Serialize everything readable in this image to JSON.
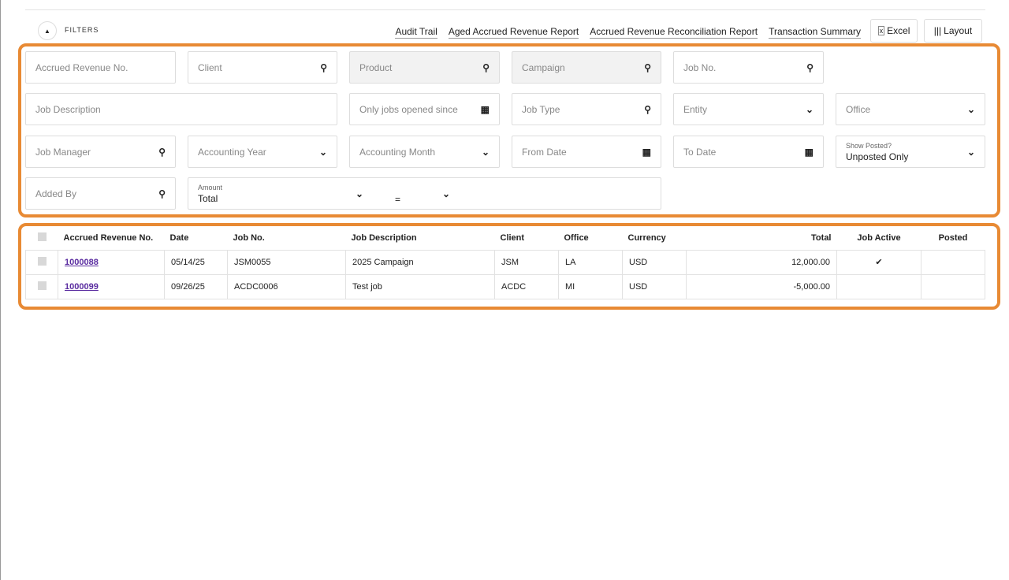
{
  "header": {
    "filters_label": "FILTERS",
    "links": [
      "Audit Trail",
      "Aged Accrued Revenue Report",
      "Accrued Revenue Reconciliation Report",
      "Transaction Summary"
    ],
    "excel": "Excel",
    "layout": "Layout"
  },
  "filters": {
    "accrued_no": "Accrued Revenue No.",
    "client": "Client",
    "product": "Product",
    "campaign": "Campaign",
    "job_no": "Job No.",
    "job_description": "Job Description",
    "opened_since": "Only jobs opened since",
    "job_type": "Job Type",
    "entity": "Entity",
    "office": "Office",
    "job_manager": "Job Manager",
    "accounting_year": "Accounting Year",
    "accounting_month": "Accounting Month",
    "from_date": "From Date",
    "to_date": "To Date",
    "show_posted_label": "Show Posted?",
    "show_posted_value": "Unposted Only",
    "added_by": "Added By",
    "amount_label": "Amount",
    "amount_value": "Total",
    "amount_operator": "="
  },
  "table": {
    "headers": [
      "Accrued Revenue No.",
      "Date",
      "Job No.",
      "Job Description",
      "Client",
      "Office",
      "Currency",
      "Total",
      "Job Active",
      "Posted"
    ],
    "rows": [
      {
        "no": "1000088",
        "date": "05/14/25",
        "job_no": "JSM0055",
        "desc": "2025 Campaign",
        "client": "JSM",
        "office": "LA",
        "currency": "USD",
        "total": "12,000.00",
        "active": "✔",
        "posted": ""
      },
      {
        "no": "1000099",
        "date": "09/26/25",
        "job_no": "ACDC0006",
        "desc": "Test job",
        "client": "ACDC",
        "office": "MI",
        "currency": "USD",
        "total": "-5,000.00",
        "active": "",
        "posted": ""
      }
    ]
  }
}
